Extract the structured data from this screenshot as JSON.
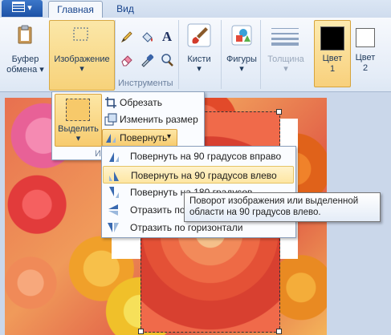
{
  "colors": {
    "accent": "#f7d27a",
    "ribbon_bg": "#e4ecf7",
    "tab_active_text": "#15428b"
  },
  "app_menu": {
    "icon": "menu-icon",
    "arrow": "▾"
  },
  "tabs": [
    {
      "label": "Главная",
      "active": true
    },
    {
      "label": "Вид",
      "active": false
    }
  ],
  "ribbon": {
    "clipboard": {
      "label_line1": "Буфер",
      "label_line2": "обмена",
      "arrow": "▾",
      "icon": "clipboard-icon"
    },
    "image": {
      "label": "Изображение",
      "arrow": "▾",
      "icon": "select-rect-icon"
    },
    "tools": {
      "group_label": "Инструменты",
      "icons": [
        "pencil-icon",
        "fill-bucket-icon",
        "text-icon",
        "eraser-icon",
        "color-picker-icon",
        "magnifier-icon"
      ],
      "text_glyph": "A"
    },
    "brushes": {
      "label": "Кисти",
      "arrow": "▾",
      "icon": "brush-icon"
    },
    "shapes": {
      "label": "Фигуры",
      "arrow": "▾",
      "icon": "shapes-icon"
    },
    "size": {
      "label": "Толщина",
      "arrow": "▾",
      "icon": "line-width-icon"
    },
    "color1": {
      "label_line1": "Цвет",
      "label_line2": "1",
      "swatch": "#000000"
    },
    "color2": {
      "label_line1": "Цвет",
      "label_line2": "2",
      "swatch": "#ffffff"
    },
    "image_group_fragment": "И"
  },
  "image_dropdown": {
    "select": {
      "label": "Выделить",
      "arrow": "▾"
    },
    "items": [
      {
        "label": "Обрезать",
        "icon": "crop-icon"
      },
      {
        "label": "Изменить размер",
        "icon": "resize-icon"
      }
    ],
    "rotate": {
      "label": "Повернуть",
      "arrow": "▾",
      "icon": "rotate-icon"
    }
  },
  "rotate_menu": {
    "items": [
      {
        "label": "Повернуть на 90 градусов вправо",
        "icon": "rotate-right-icon",
        "highlighted": false
      },
      {
        "label": "Повернуть на 90 градусов влево",
        "icon": "rotate-left-icon",
        "highlighted": true
      },
      {
        "label": "Повернуть на 180 градусов",
        "icon": "rotate-180-icon",
        "highlighted": false
      },
      {
        "label": "Отразить по вертикали",
        "icon": "flip-vertical-icon",
        "highlighted": false
      },
      {
        "label": "Отразить по горизонтали",
        "icon": "flip-horizontal-icon",
        "highlighted": false
      }
    ]
  },
  "tooltip": {
    "text": "Поворот изображения или выделенной области на 90 градусов влево."
  }
}
